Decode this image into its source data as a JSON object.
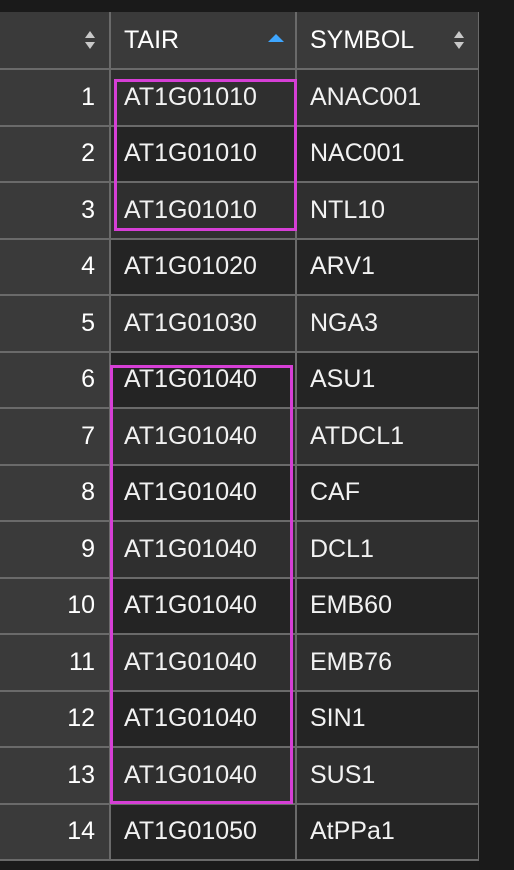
{
  "table": {
    "columns": [
      {
        "label": "",
        "sort": "none"
      },
      {
        "label": "TAIR",
        "sort": "ascending"
      },
      {
        "label": "SYMBOL",
        "sort": "none"
      }
    ],
    "rows": [
      {
        "num": "1",
        "tair": "AT1G01010",
        "symbol": "ANAC001"
      },
      {
        "num": "2",
        "tair": "AT1G01010",
        "symbol": "NAC001"
      },
      {
        "num": "3",
        "tair": "AT1G01010",
        "symbol": "NTL10"
      },
      {
        "num": "4",
        "tair": "AT1G01020",
        "symbol": "ARV1"
      },
      {
        "num": "5",
        "tair": "AT1G01030",
        "symbol": "NGA3"
      },
      {
        "num": "6",
        "tair": "AT1G01040",
        "symbol": "ASU1"
      },
      {
        "num": "7",
        "tair": "AT1G01040",
        "symbol": "ATDCL1"
      },
      {
        "num": "8",
        "tair": "AT1G01040",
        "symbol": "CAF"
      },
      {
        "num": "9",
        "tair": "AT1G01040",
        "symbol": "DCL1"
      },
      {
        "num": "10",
        "tair": "AT1G01040",
        "symbol": "EMB60"
      },
      {
        "num": "11",
        "tair": "AT1G01040",
        "symbol": "EMB76"
      },
      {
        "num": "12",
        "tair": "AT1G01040",
        "symbol": "SIN1"
      },
      {
        "num": "13",
        "tair": "AT1G01040",
        "symbol": "SUS1"
      },
      {
        "num": "14",
        "tair": "AT1G01050",
        "symbol": "AtPPa1"
      }
    ]
  },
  "colors": {
    "highlight": "#d63fd6",
    "sort_active": "#3ea6ff",
    "sort_inactive": "#c8c8c8"
  },
  "icons": {
    "sort_neutral": "sort-updown-icon",
    "sort_ascending": "sort-ascending-icon"
  }
}
